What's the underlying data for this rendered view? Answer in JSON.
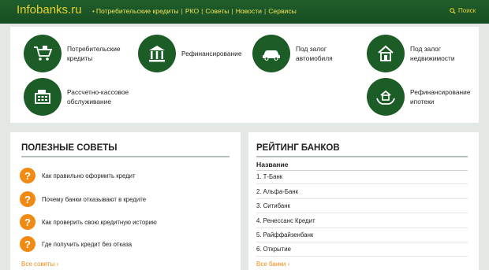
{
  "header": {
    "logo": "Infobanks.ru",
    "nav": [
      "Потребительские кредиты",
      "РКО",
      "Советы",
      "Новости",
      "Сервисы"
    ],
    "search_label": "Поиск"
  },
  "services": [
    {
      "line1": "Потребительские",
      "line2": "кредиты",
      "icon": "cart-icon"
    },
    {
      "line1": "Рефинансирование",
      "line2": "",
      "icon": "bank-icon"
    },
    {
      "line1": "Под залог",
      "line2": "автомобиля",
      "icon": "car-icon"
    },
    {
      "line1": "Под залог",
      "line2": "недвижимости",
      "icon": "house-icon"
    },
    {
      "line1": "Рассчетно-кассовое",
      "line2": "обслуживание",
      "icon": "cash-register-icon"
    },
    {
      "line1": "Рефинансирование",
      "line2": "ипотеки",
      "icon": "house-hands-icon"
    }
  ],
  "tips": {
    "title": "ПОЛЕЗНЫЕ СОВЕТЫ",
    "items": [
      "Как правильно оформить кредит",
      "Почему банки отказывают в кредите",
      "Как проверить свою кредитную историю",
      "Где получить кредит без отказа"
    ],
    "more": "Все советы ›"
  },
  "rating": {
    "title": "РЕЙТИНГ БАНКОВ",
    "column": "Название",
    "rows": [
      "1. Т-Банк",
      "2. Альфа-Банк",
      "3. Ситибанк",
      "4. Ренессанс Кредит",
      "5. Райффайзенбанк",
      "6. Открытие"
    ],
    "more": "Все банки ›"
  },
  "colors": {
    "header_bg": "#1f5e2a",
    "logo": "#e6d233",
    "icon_circle": "#1c5c27",
    "accent_orange": "#f08a12"
  }
}
